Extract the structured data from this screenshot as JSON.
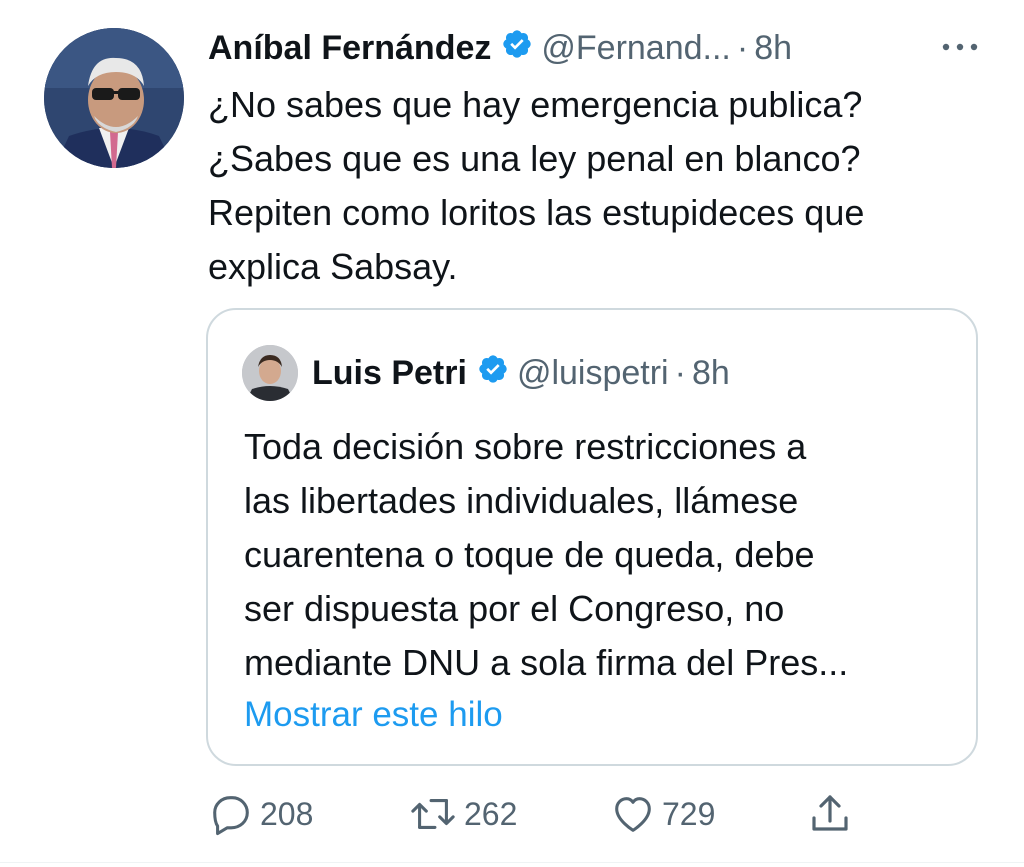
{
  "tweet": {
    "author_name": "Aníbal Fernández",
    "author_handle": "@Fernand...",
    "separator": "·",
    "time": "8h",
    "text_lines": [
      "¿No sabes que hay emergencia publica?",
      "¿Sabes que es una ley penal en blanco?",
      "Repiten como loritos las estupideces que",
      "explica Sabsay."
    ],
    "avatar_icon": "profile-photo",
    "verified_icon": "verified-badge-icon",
    "more_icon": "more-options-icon"
  },
  "quoted": {
    "author_name": "Luis Petri",
    "author_handle": "@luispetri",
    "separator": "·",
    "time": "8h",
    "text_lines": [
      "Toda decisión sobre restricciones a",
      "las libertades individuales, llámese",
      "cuarentena o toque de queda, debe",
      "ser dispuesta por el Congreso, no",
      "mediante DNU a sola firma del Pres..."
    ],
    "thread_link": "Mostrar este hilo"
  },
  "actions": {
    "reply_count": "208",
    "retweet_count": "262",
    "like_count": "729",
    "reply_icon": "reply-icon",
    "retweet_icon": "retweet-icon",
    "like_icon": "heart-icon",
    "share_icon": "share-icon"
  },
  "colors": {
    "link": "#1d9bf0",
    "verified": "#1d9bf0",
    "secondary_text": "#536471",
    "primary_text": "#0f1419",
    "border": "#cfd9de"
  }
}
